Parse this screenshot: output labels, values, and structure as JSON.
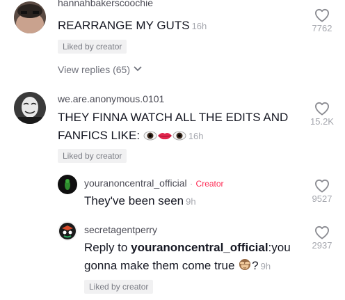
{
  "comments": [
    {
      "username": "hannahbakerscoochie",
      "text": "REARRANGE MY GUTS",
      "time": "16h",
      "badge": "Liked by creator",
      "likes": "7762",
      "view_replies": "View replies (65)"
    },
    {
      "username": "we.are.anonymous.0101",
      "text_line1": "THEY FINNA WATCH ALL THE EDITS AND",
      "text_line2": "FANFICS LIKE:",
      "time": "16h",
      "badge": "Liked by creator",
      "likes": "15.2K",
      "emoji": [
        "eye-emoji",
        "lips-emoji",
        "eye-emoji"
      ]
    }
  ],
  "replies": [
    {
      "username": "youranoncentral_official",
      "separator": "·",
      "creator_label": "Creator",
      "text": "They've been seen",
      "time": "9h",
      "likes": "9527"
    },
    {
      "username": "secretagentperry",
      "prefix": "Reply to",
      "mention": "youranoncentral_official",
      "text_rest": ":you",
      "text_line2": "gonna make them come true",
      "text_suffix": "?",
      "time": "9h",
      "badge": "Liked by creator",
      "likes": "2937",
      "emoji": "see-no-evil-monkey-emoji"
    }
  ],
  "icons": {
    "like": "heart-outline-icon",
    "expand": "chevron-down-icon"
  },
  "colors": {
    "creator": "#fe2c55",
    "text": "#161823",
    "muted": "#a4a6ad",
    "badge_bg": "#f1f1f2"
  }
}
